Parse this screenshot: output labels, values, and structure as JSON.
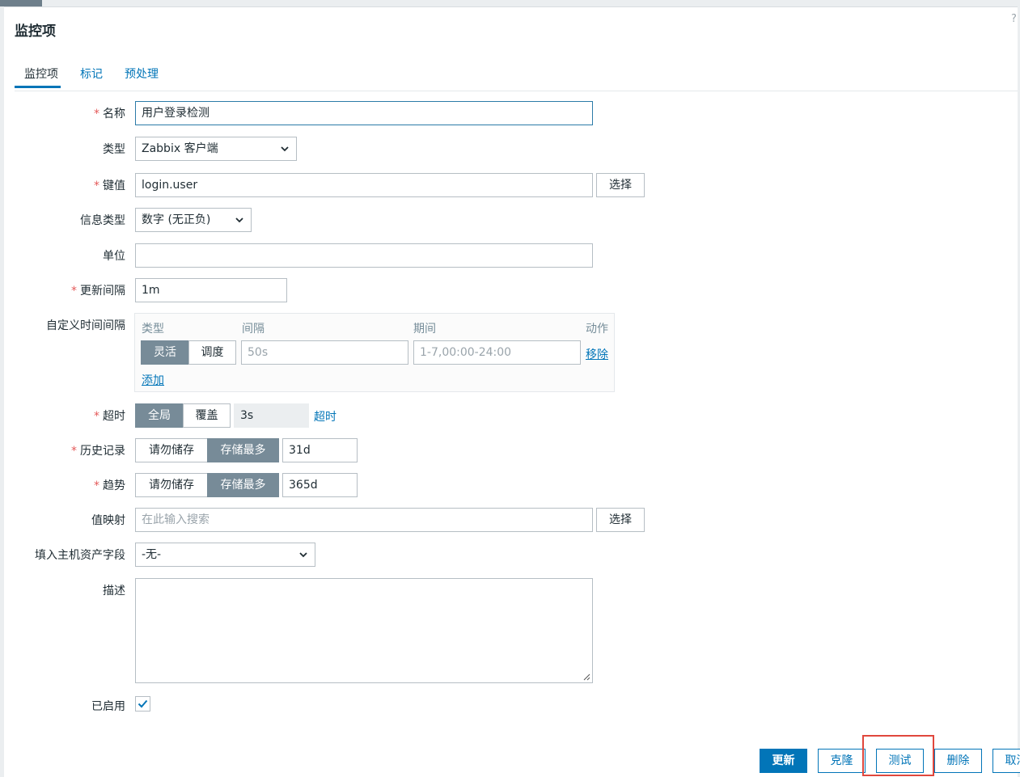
{
  "header": {
    "title": "监控项",
    "help_glyph": "?"
  },
  "tabs": [
    {
      "label": "监控项",
      "active": true
    },
    {
      "label": "标记",
      "active": false
    },
    {
      "label": "预处理",
      "active": false
    }
  ],
  "form": {
    "name": {
      "label": "名称",
      "required": true,
      "value": "用户登录检测"
    },
    "type": {
      "label": "类型",
      "value": "Zabbix 客户端"
    },
    "key": {
      "label": "键值",
      "required": true,
      "value": "login.user",
      "button": "选择"
    },
    "value_type": {
      "label": "信息类型",
      "value": "数字 (无正负)"
    },
    "units": {
      "label": "单位",
      "value": ""
    },
    "update_interval": {
      "label": "更新间隔",
      "required": true,
      "value": "1m"
    },
    "custom_intervals": {
      "label": "自定义时间间隔",
      "columns": [
        "类型",
        "间隔",
        "期间",
        "动作"
      ],
      "row": {
        "type_options": [
          "灵活",
          "调度"
        ],
        "type_selected": "灵活",
        "interval_placeholder": "50s",
        "period_placeholder": "1-7,00:00-24:00",
        "remove": "移除"
      },
      "add": "添加"
    },
    "timeout": {
      "label": "超时",
      "required": true,
      "options": [
        "全局",
        "覆盖"
      ],
      "selected": "全局",
      "value": "3s",
      "link": "超时"
    },
    "history": {
      "label": "历史记录",
      "required": true,
      "options": [
        "请勿储存",
        "存储最多"
      ],
      "selected": "存储最多",
      "value": "31d"
    },
    "trends": {
      "label": "趋势",
      "required": true,
      "options": [
        "请勿储存",
        "存储最多"
      ],
      "selected": "存储最多",
      "value": "365d"
    },
    "valuemap": {
      "label": "值映射",
      "placeholder": "在此输入搜索",
      "button": "选择"
    },
    "inventory": {
      "label": "填入主机资产字段",
      "value": "-无-"
    },
    "description": {
      "label": "描述",
      "value": ""
    },
    "enabled": {
      "label": "已启用",
      "checked": true
    }
  },
  "footer": {
    "update": "更新",
    "clone": "克隆",
    "test": "测试",
    "delete": "删除",
    "cancel": "取消"
  },
  "colors": {
    "accent": "#0275b8",
    "segment_active": "#778b98",
    "required": "#e45959",
    "highlight_box": "#e0473d"
  }
}
